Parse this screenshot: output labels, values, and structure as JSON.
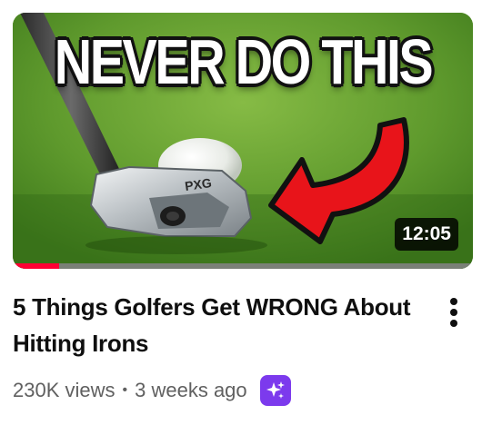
{
  "video": {
    "thumbnail_headline": "NEVER DO THIS",
    "duration": "12:05",
    "watch_progress_fraction": 0.1,
    "title": "5 Things Golfers Get WRONG About Hitting Irons",
    "views": "230K views",
    "separator": "•",
    "age": "3 weeks ago"
  },
  "icons": {
    "more": "more-vert-icon",
    "ai_badge": "sparkle-icon"
  },
  "colors": {
    "progress": "#ff0033",
    "ai_badge": "#7c3aed",
    "arrow": "#e8141a",
    "title": "#0f0f0f",
    "meta": "#606060"
  }
}
